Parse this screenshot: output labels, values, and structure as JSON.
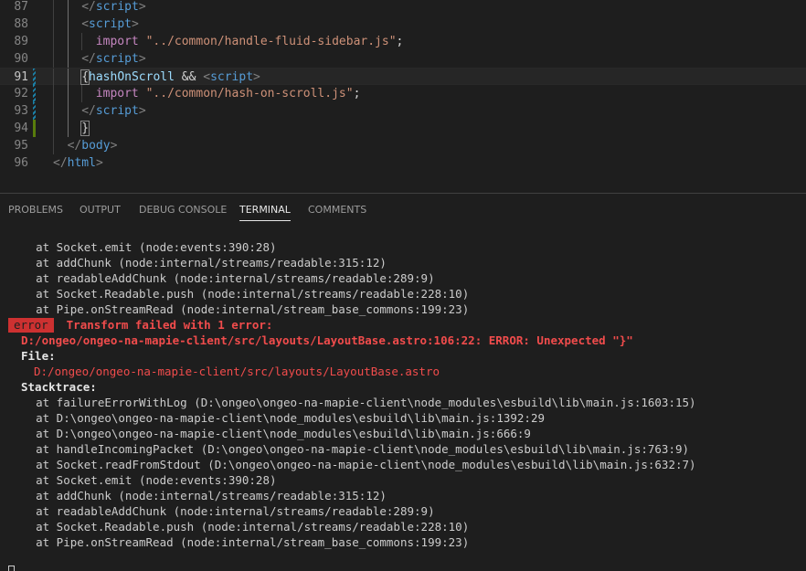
{
  "editor": {
    "lines": [
      {
        "num": "87",
        "indent": 2,
        "tokens": [
          [
            "tk-bracket",
            "</"
          ],
          [
            "tk-tag",
            "script"
          ],
          [
            "tk-bracket",
            ">"
          ]
        ]
      },
      {
        "num": "88",
        "indent": 2,
        "tokens": [
          [
            "tk-bracket",
            "<"
          ],
          [
            "tk-tag",
            "script"
          ],
          [
            "tk-bracket",
            ">"
          ]
        ]
      },
      {
        "num": "89",
        "indent": 3,
        "tokens": [
          [
            "tk-kw",
            "import"
          ],
          [
            "tk-punct",
            " "
          ],
          [
            "tk-str",
            "\"../common/handle-fluid-sidebar.js\""
          ],
          [
            "tk-punct",
            ";"
          ]
        ]
      },
      {
        "num": "90",
        "indent": 2,
        "tokens": [
          [
            "tk-bracket",
            "</"
          ],
          [
            "tk-tag",
            "script"
          ],
          [
            "tk-bracket",
            ">"
          ]
        ]
      },
      {
        "num": "91",
        "indent": 2,
        "tokens": [
          [
            "tk-brace brace-match",
            "{"
          ],
          [
            "tk-var",
            "hashOnScroll"
          ],
          [
            "tk-expr",
            " && "
          ],
          [
            "tk-bracket",
            "<"
          ],
          [
            "tk-tag",
            "script"
          ],
          [
            "tk-bracket",
            ">"
          ]
        ]
      },
      {
        "num": "92",
        "indent": 3,
        "tokens": [
          [
            "tk-kw",
            "import"
          ],
          [
            "tk-punct",
            " "
          ],
          [
            "tk-str",
            "\"../common/hash-on-scroll.js\""
          ],
          [
            "tk-punct",
            ";"
          ]
        ]
      },
      {
        "num": "93",
        "indent": 2,
        "tokens": [
          [
            "tk-bracket",
            "</"
          ],
          [
            "tk-tag",
            "script"
          ],
          [
            "tk-bracket",
            ">"
          ]
        ]
      },
      {
        "num": "94",
        "indent": 2,
        "tokens": [
          [
            "tk-brace brace-match",
            "}"
          ]
        ]
      },
      {
        "num": "95",
        "indent": 1,
        "tokens": [
          [
            "tk-bracket",
            "</"
          ],
          [
            "tk-tag",
            "body"
          ],
          [
            "tk-bracket",
            ">"
          ]
        ]
      },
      {
        "num": "96",
        "indent": 0,
        "tokens": [
          [
            "tk-bracket",
            "</"
          ],
          [
            "tk-tag",
            "html"
          ],
          [
            "tk-bracket",
            ">"
          ]
        ]
      }
    ],
    "current_line": "91",
    "modified_lines": [
      "91",
      "92",
      "93"
    ],
    "added_lines": [
      "94"
    ]
  },
  "panel": {
    "tabs": [
      "PROBLEMS",
      "OUTPUT",
      "DEBUG CONSOLE",
      "TERMINAL",
      "COMMENTS"
    ],
    "active_tab": "TERMINAL"
  },
  "terminal": {
    "pre_lines": [
      "    at Socket.emit (node:events:390:28)",
      "    at addChunk (node:internal/streams/readable:315:12)",
      "    at readableAddChunk (node:internal/streams/readable:289:9)",
      "    at Socket.Readable.push (node:internal/streams/readable:228:10)",
      "    at Pipe.onStreamRead (node:internal/stream_base_commons:199:23)"
    ],
    "error_badge": "error",
    "error_message": "Transform failed with 1 error:",
    "error_location": "D:/ongeo/ongeo-na-mapie-client/src/layouts/LayoutBase.astro:106:22: ERROR: Unexpected \"}\"",
    "file_label": "File:",
    "file_path": "D:/ongeo/ongeo-na-mapie-client/src/layouts/LayoutBase.astro",
    "stacktrace_label": "Stacktrace:",
    "stack_lines": [
      "    at failureErrorWithLog (D:\\ongeo\\ongeo-na-mapie-client\\node_modules\\esbuild\\lib\\main.js:1603:15)",
      "    at D:\\ongeo\\ongeo-na-mapie-client\\node_modules\\esbuild\\lib\\main.js:1392:29",
      "    at D:\\ongeo\\ongeo-na-mapie-client\\node_modules\\esbuild\\lib\\main.js:666:9",
      "    at handleIncomingPacket (D:\\ongeo\\ongeo-na-mapie-client\\node_modules\\esbuild\\lib\\main.js:763:9)",
      "    at Socket.readFromStdout (D:\\ongeo\\ongeo-na-mapie-client\\node_modules\\esbuild\\lib\\main.js:632:7)",
      "    at Socket.emit (node:events:390:28)",
      "    at addChunk (node:internal/streams/readable:315:12)",
      "    at readableAddChunk (node:internal/streams/readable:289:9)",
      "    at Socket.Readable.push (node:internal/streams/readable:228:10)",
      "    at Pipe.onStreamRead (node:internal/stream_base_commons:199:23)"
    ]
  }
}
